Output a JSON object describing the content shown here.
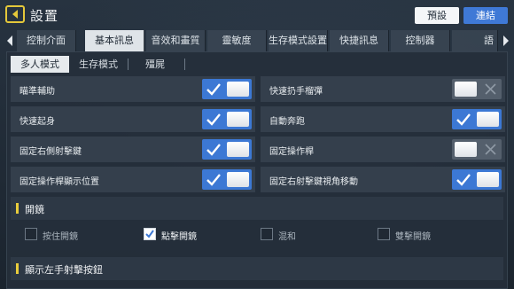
{
  "header": {
    "title": "設置",
    "preset_label": "預設",
    "connect_label": "連結"
  },
  "tabs": [
    {
      "label": "控制介面",
      "active": false
    },
    {
      "label": "基本訊息",
      "active": true
    },
    {
      "label": "音效和畫質",
      "active": false
    },
    {
      "label": "靈敏度",
      "active": false
    },
    {
      "label": "生存模式設置",
      "active": false
    },
    {
      "label": "快捷訊息",
      "active": false
    },
    {
      "label": "控制器",
      "active": false
    },
    {
      "label": "語",
      "active": false
    }
  ],
  "subtabs": [
    {
      "label": "多人模式",
      "active": true
    },
    {
      "label": "生存模式",
      "active": false
    },
    {
      "label": "殭屍",
      "active": false
    }
  ],
  "toggles": [
    {
      "label": "瞄準輔助",
      "state": "on"
    },
    {
      "label": "快速扔手榴彈",
      "state": "off"
    },
    {
      "label": "快速起身",
      "state": "on"
    },
    {
      "label": "自動奔跑",
      "state": "on"
    },
    {
      "label": "固定右側射擊鍵",
      "state": "on"
    },
    {
      "label": "固定操作桿",
      "state": "off"
    },
    {
      "label": "固定操作桿顯示位置",
      "state": "on"
    },
    {
      "label": "固定右射擊鍵視角移動",
      "state": "on"
    }
  ],
  "scope_section": {
    "title": "開鏡",
    "options": [
      {
        "label": "按住開鏡",
        "checked": false
      },
      {
        "label": "點擊開鏡",
        "checked": true
      },
      {
        "label": "混和",
        "checked": false
      },
      {
        "label": "雙擊開鏡",
        "checked": false
      }
    ]
  },
  "left_fire_section": {
    "title": "顯示左手射擊按鈕"
  },
  "colors": {
    "accent_blue": "#3c78d4",
    "accent_yellow": "#e9cd3c"
  }
}
